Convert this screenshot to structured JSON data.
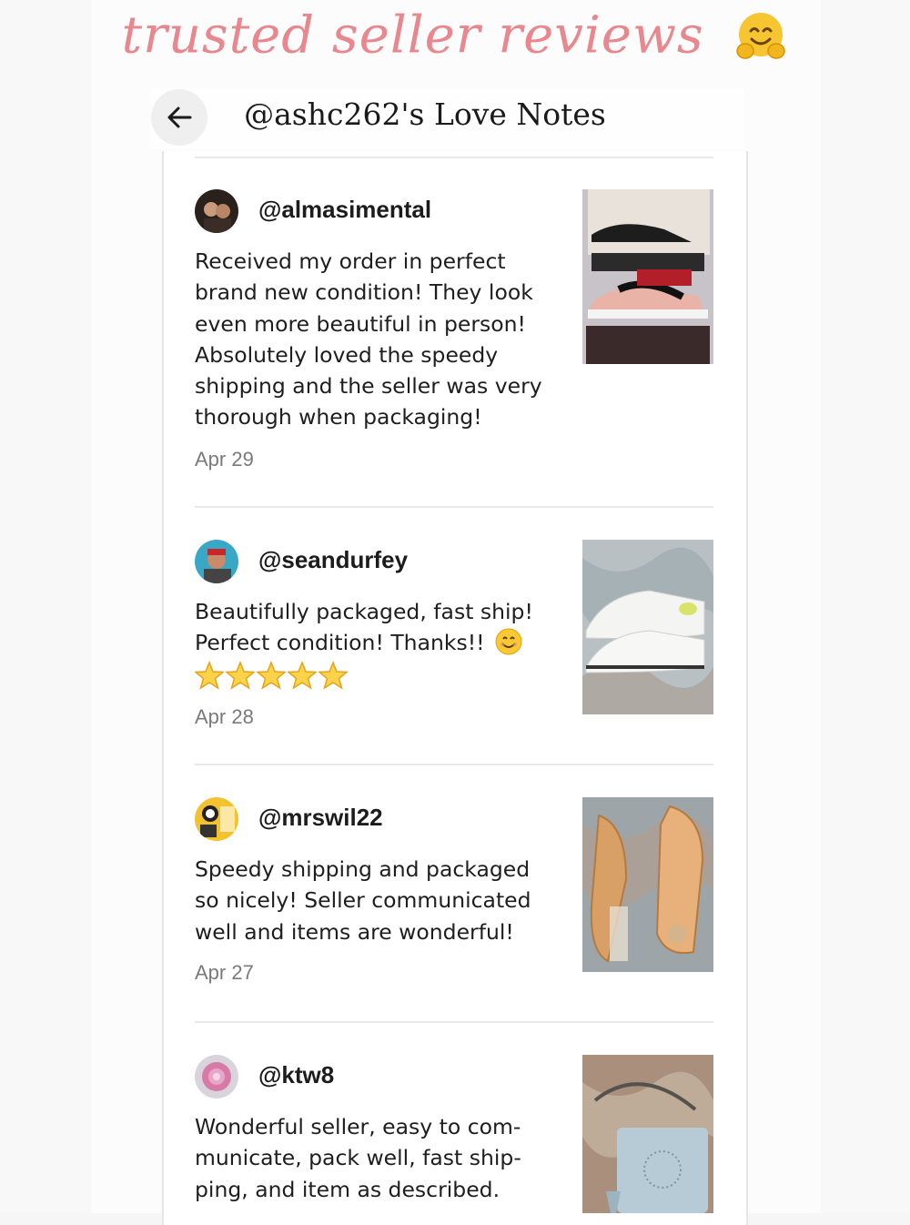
{
  "banner": {
    "title": "trusted seller reviews"
  },
  "header": {
    "title": "@ashc262's Love Notes"
  },
  "reviews": [
    {
      "username": "@almasimental",
      "text": "Received my order in perfect brand new condition! They look even more beautiful in person! Absolutely loved the speedy shipping and the seller was very thorough when packaging!",
      "date": "Apr 29"
    },
    {
      "username": "@seandurfey",
      "text": "Beautifully packaged, fast ship! Perfect condition! Thanks!!",
      "rating": 5,
      "date": "Apr 28"
    },
    {
      "username": "@mrswil22",
      "text": "Speedy shipping and packaged so nicely! Seller communicated well and items are wonderful!",
      "date": "Apr 27"
    },
    {
      "username": "@ktw8",
      "text": "Wonderful seller, easy to com-municate, pack well, fast ship-ping, and item as described."
    }
  ],
  "colors": {
    "banner_pink": "#e8878d",
    "date_gray": "#7a7a7a",
    "divider": "#e9e9e9"
  },
  "icons": [
    "hugging-face-icon",
    "back-arrow-icon",
    "smiling-face-icon",
    "star-icon"
  ]
}
